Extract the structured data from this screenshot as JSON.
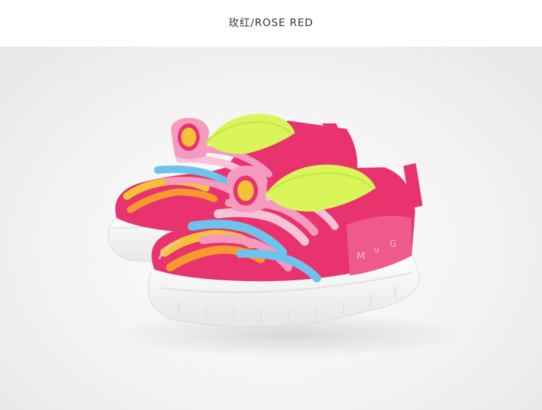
{
  "caption": {
    "color_label": "玫红/ROSE RED"
  },
  "product_photo": {
    "subject": "pair of rainbow-striped slip-on kids sneakers",
    "colors": {
      "rose": "#e8336f",
      "pink": "#f59bbf",
      "light_pink": "#f8c3d6",
      "sky_blue": "#6ec3ec",
      "yellow": "#f6c23a",
      "orange": "#f79a2e",
      "lime": "#d9f55a",
      "sole_white": "#f7f7f7"
    }
  }
}
